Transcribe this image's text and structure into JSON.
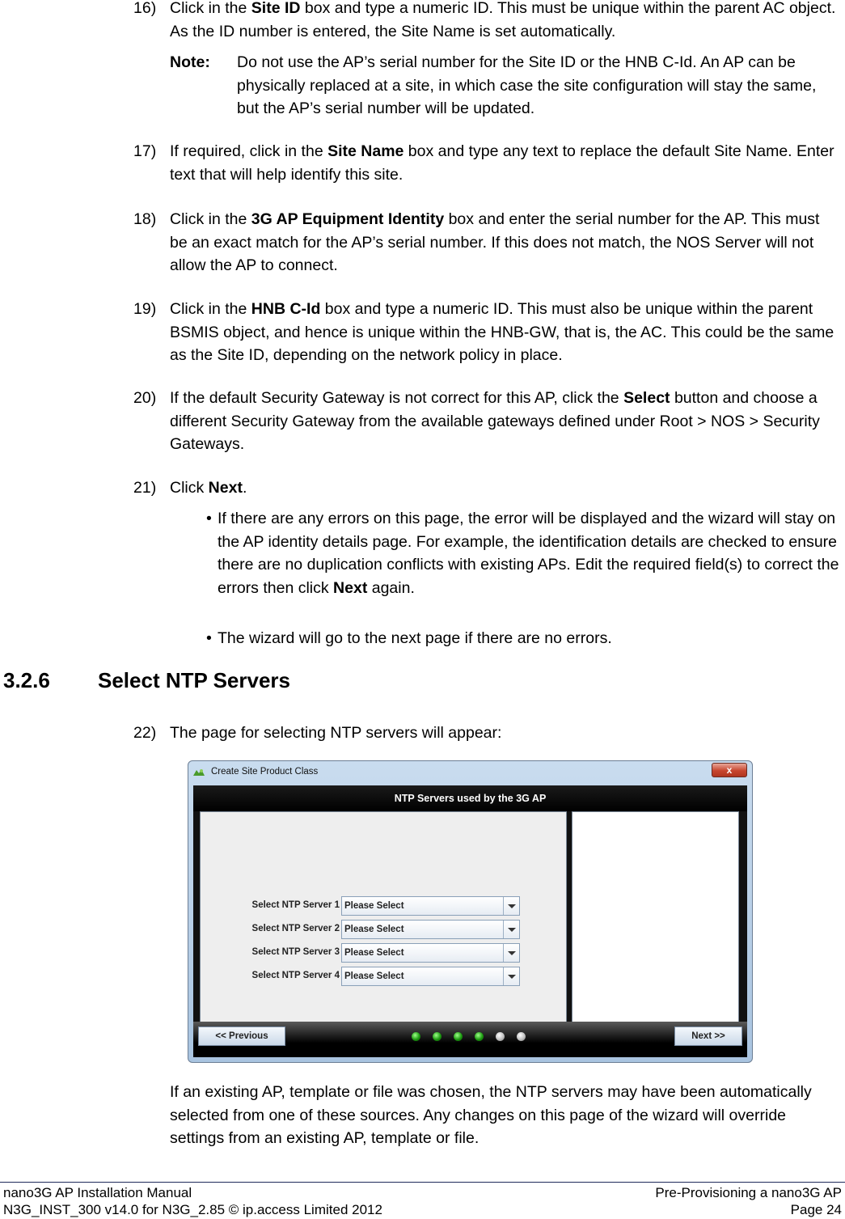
{
  "steps": {
    "s16": {
      "num": "16)",
      "pre": "Click in the ",
      "bold": "Site ID",
      "post": " box and type a numeric ID. This must be unique within the parent AC object. As the ID number is entered, the Site Name is set automatically."
    },
    "note": {
      "label": "Note:",
      "text": "Do not use the AP’s serial number for the Site ID or the HNB C-Id. An AP can be physically replaced at a site, in which case the site configuration will stay the same, but the AP’s serial number will be updated."
    },
    "s17": {
      "num": "17)",
      "pre": "If required, click in the ",
      "bold": "Site Name",
      "post": " box and type any text to replace the default Site Name. Enter text that will help identify this site."
    },
    "s18": {
      "num": "18)",
      "pre": "Click in the ",
      "bold": "3G AP Equipment Identity",
      "post": " box and enter the serial number for the AP. This must be an exact match for the AP’s serial number. If this does not match, the NOS Server will not allow the AP to connect."
    },
    "s19": {
      "num": "19)",
      "pre": "Click in the ",
      "bold": "HNB C-Id",
      "post": " box and type a numeric ID. This must also be unique within the parent BSMIS object, and hence is unique within the HNB-GW, that is, the AC. This could be the same as the Site ID, depending on the network policy in place."
    },
    "s20": {
      "num": "20)",
      "pre": "If the default Security Gateway is not correct for this AP, click the ",
      "bold": "Select",
      "post": " button and choose a different Security Gateway from the available gateways defined under Root > NOS > Security Gateways."
    },
    "s21": {
      "num": "21)",
      "pre": "Click ",
      "bold": "Next",
      "post": "."
    },
    "bullet1": {
      "dot": "•",
      "pre": " If there are any errors on this page, the error will be displayed and the wizard will stay on the AP identity details page. For example, the identification details are checked to ensure there are no duplication conflicts with existing APs. Edit the required field(s) to correct the errors then click ",
      "bold": "Next",
      "post": " again."
    },
    "bullet2": {
      "dot": "•",
      "text": "The wizard will go to the next page if there are no errors."
    },
    "s22": {
      "num": "22)",
      "text": "The page for selecting NTP servers will appear:"
    }
  },
  "section": {
    "number": "3.2.6",
    "title": "Select NTP Servers"
  },
  "dialog": {
    "title": "Create Site Product Class",
    "close_label": "x",
    "banner": "NTP Servers used by the 3G AP",
    "rows": [
      {
        "label": "Select NTP Server 1",
        "value": "Please Select"
      },
      {
        "label": "Select NTP Server 2",
        "value": "Please Select"
      },
      {
        "label": "Select NTP Server 3",
        "value": "Please Select"
      },
      {
        "label": "Select NTP Server 4",
        "value": "Please Select"
      }
    ],
    "prev_label": "<< Previous",
    "next_label": "Next >>",
    "progress": {
      "completed_steps": 4,
      "total_steps": 6
    }
  },
  "after_text": "If an existing AP, template or file was chosen, the NTP servers may have been automatically selected from one of these sources. Any changes on this page of the wizard will override settings from an existing AP, template or file.",
  "footer": {
    "left1": "nano3G AP Installation Manual",
    "left2": "N3G_INST_300 v14.0 for N3G_2.85 © ip.access Limited 2012",
    "right1": "Pre-Provisioning a nano3G AP",
    "right2": "Page 24"
  }
}
